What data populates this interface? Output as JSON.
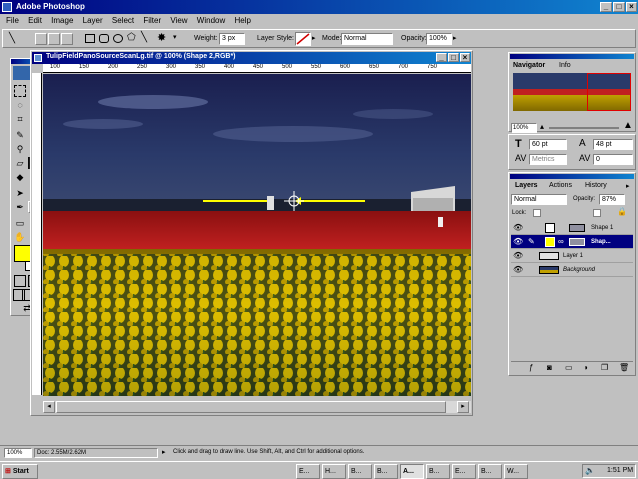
{
  "app": {
    "title": "Adobe Photoshop"
  },
  "menu": [
    "File",
    "Edit",
    "Image",
    "Layer",
    "Select",
    "Filter",
    "View",
    "Window",
    "Help"
  ],
  "options_bar": {
    "weight_label": "Weight:",
    "weight_value": "3 px",
    "layer_style_label": "Layer Style:",
    "mode_label": "Mode:",
    "mode_value": "Normal",
    "opacity_label": "Opacity:",
    "opacity_value": "100%"
  },
  "document": {
    "title": "TulipFieldPanoSourceScanLg.tif @ 100% (Shape 2,RGB*)",
    "ruler_ticks": [
      "100",
      "150",
      "200",
      "250",
      "300",
      "350",
      "400",
      "450",
      "500",
      "550",
      "600",
      "650",
      "700",
      "750"
    ]
  },
  "navigator": {
    "tabs": [
      "Navigator",
      "Info"
    ],
    "zoom": "100%"
  },
  "character": {
    "font_size": "60 pt",
    "leading": "48 pt",
    "tracking": "Metrics",
    "kerning": "0"
  },
  "layers_panel": {
    "tabs": [
      "Layers",
      "Actions",
      "History"
    ],
    "blend_mode": "Normal",
    "opacity_label": "Opacity:",
    "opacity_value": "87%",
    "lock_label": "Lock:",
    "layers": [
      {
        "name": "Shape 1",
        "selected": false
      },
      {
        "name": "Shap...",
        "selected": true
      },
      {
        "name": "Layer 1",
        "selected": false
      },
      {
        "name": "Background",
        "selected": false
      }
    ]
  },
  "status_bar": {
    "zoom": "100%",
    "doc_size": "Doc: 2.55M/2.62M",
    "hint": "Click and drag to draw line. Use Shift, Alt, and Ctrl for additional options."
  },
  "taskbar": {
    "start": "Start",
    "tasks": [
      "E...",
      "H...",
      "B...",
      "B...",
      "A...",
      "B...",
      "E...",
      "B...",
      "W..."
    ],
    "clock": "1:51 PM"
  },
  "colors": {
    "title_blue": "#000080",
    "foreground_swatch": "#ffff00",
    "selected_layer": "#000080"
  }
}
